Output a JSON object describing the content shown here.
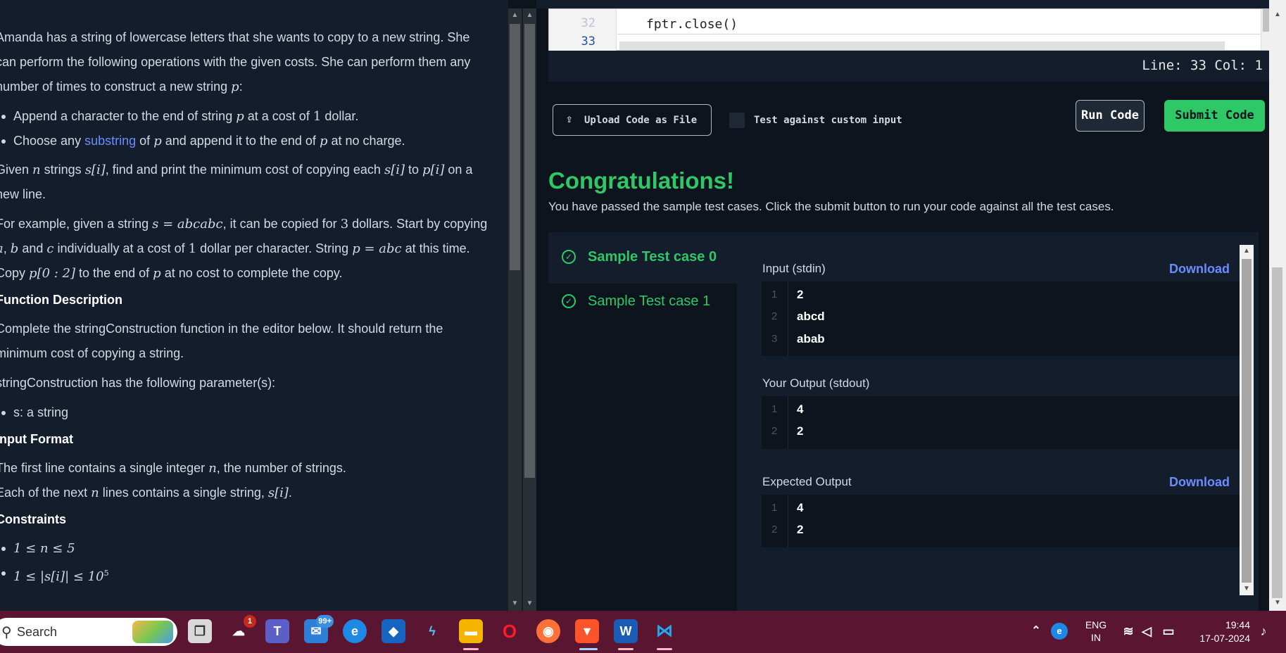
{
  "problem": {
    "intro": "Amanda has a string of lowercase letters that she wants to copy to a new string. She can perform the following operations with the given costs. She can perform them any number of times to construct a new string",
    "intro_var": "p",
    "op1_a": "Append a character to the end of string",
    "op1_var": "p",
    "op1_b": "at a cost of",
    "op1_num": "1",
    "op1_c": "dollar.",
    "op2_a": "Choose any",
    "op2_link": "substring",
    "op2_b": "of",
    "op2_var": "p",
    "op2_c": "and append it to the end of",
    "op2_var2": "p",
    "op2_d": "at no charge.",
    "given_a": "Given",
    "given_n": "n",
    "given_b": "strings",
    "given_si": "s[i]",
    "given_c": ", find and print the minimum cost of copying each",
    "given_si2": "s[i]",
    "given_d": "to",
    "given_pi": "p[i]",
    "given_e": "on a new line.",
    "ex_a": "For example, given a string",
    "ex_eq": "s = abcabc",
    "ex_b": ", it can be copied for",
    "ex_num": "3",
    "ex_c": "dollars. Start by copying",
    "ex_a_var": "a",
    "ex_comma": ",",
    "ex_b_var": "b",
    "ex_d": "and",
    "ex_c_var": "c",
    "ex_e": "individually at a cost of",
    "ex_one": "1",
    "ex_f": "dollar per character. String",
    "ex_peq": "p = abc",
    "ex_g": "at this time. Copy",
    "ex_slice": "p[0 : 2]",
    "ex_h": "to the end of",
    "ex_p": "p",
    "ex_i": "at no cost to complete the copy.",
    "h_function": "Function Description",
    "func_desc": "Complete the stringConstruction function in the editor below. It should return the minimum cost of copying a string.",
    "params_intro": "stringConstruction has the following parameter(s):",
    "param1": "s: a string",
    "h_input": "Input Format",
    "input1_a": "The first line contains a single integer",
    "input1_n": "n",
    "input1_b": ", the number of strings.",
    "input2_a": "Each of the next",
    "input2_n": "n",
    "input2_b": "lines contains a single string,",
    "input2_si": "s[i]",
    "input2_c": ".",
    "h_constraints": "Constraints",
    "c1": "1 ≤ n ≤ 5",
    "c2": "1 ≤ |s[i]| ≤ 10",
    "c2_exp": "5"
  },
  "editor": {
    "line_prev": "32",
    "line_cur": "33",
    "code_line": "fptr.close()",
    "status": "Line: 33 Col: 1"
  },
  "actions": {
    "upload_label": "Upload Code as File",
    "custom_input_label": "Test against custom input",
    "run_label": "Run Code",
    "submit_label": "Submit Code"
  },
  "result": {
    "title": "Congratulations!",
    "message": "You have passed the sample test cases. Click the submit button to run your code against all the test cases.",
    "test_cases": [
      "Sample Test case 0",
      "Sample Test case 1"
    ],
    "input_title": "Input (stdin)",
    "input_lines": [
      "2",
      "abcd",
      "abab"
    ],
    "output_title": "Your Output (stdout)",
    "output_lines": [
      "4",
      "2"
    ],
    "expected_title": "Expected Output",
    "expected_lines": [
      "4",
      "2"
    ],
    "download_label": "Download"
  },
  "taskbar": {
    "search_placeholder": "Search",
    "teams_badge": "1",
    "mail_badge": "99+",
    "lang_line1": "ENG",
    "lang_line2": "IN",
    "time": "19:44",
    "date": "17-07-2024"
  },
  "colors": {
    "accent_green": "#2ec866",
    "link_blue": "#6b8cff",
    "bg_dark": "#0e141e",
    "taskbar": "#5a1630"
  }
}
